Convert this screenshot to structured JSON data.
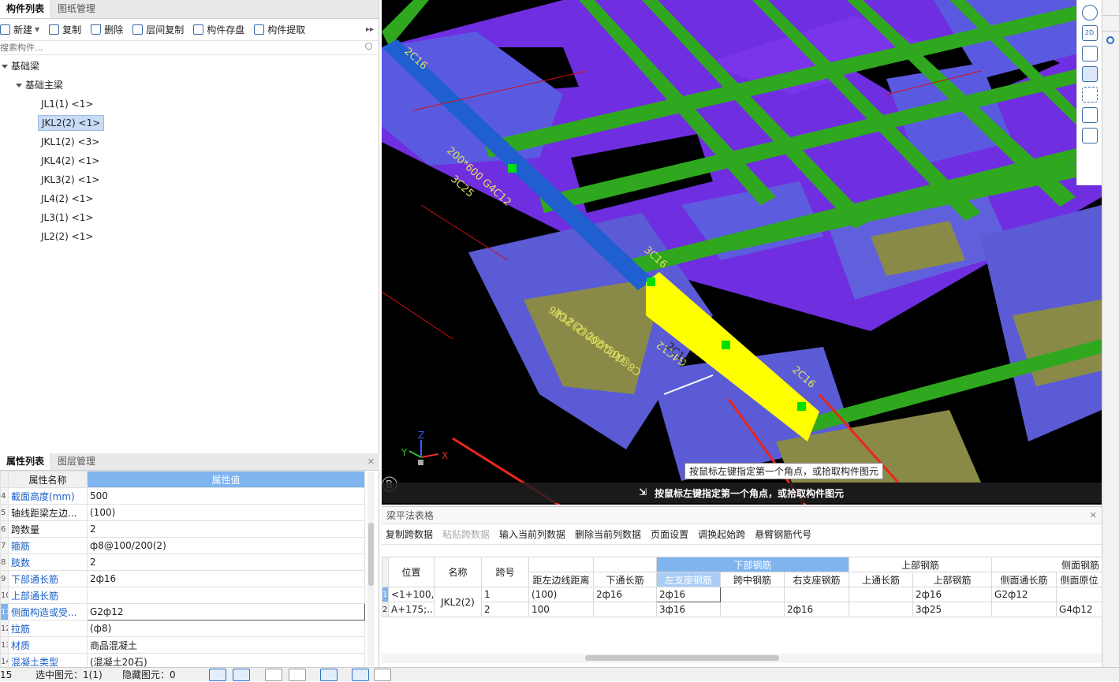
{
  "left_panel": {
    "tabs": [
      "构件列表",
      "图纸管理"
    ],
    "toolbar": [
      {
        "label": "新建",
        "icon": "new-icon"
      },
      {
        "label": "复制",
        "icon": "copy-icon"
      },
      {
        "label": "删除",
        "icon": "delete-icon"
      },
      {
        "label": "层间复制",
        "icon": "floor-copy-icon"
      },
      {
        "label": "构件存盘",
        "icon": "save-component-icon"
      },
      {
        "label": "构件提取",
        "icon": "extract-component-icon"
      }
    ],
    "search_placeholder": "搜索构件...",
    "tree": {
      "root": "基础梁",
      "group": "基础主梁",
      "items": [
        "JL1(1) <1>",
        "JKL2(2) <1>",
        "JKL1(2) <3>",
        "JKL4(2) <1>",
        "JKL3(2) <1>",
        "JL4(2) <1>",
        "JL3(1) <1>",
        "JL2(2) <1>"
      ],
      "selected_index": 1
    }
  },
  "property_panel": {
    "tabs": [
      "属性列表",
      "图层管理"
    ],
    "header": {
      "name": "属性名称",
      "value": "属性值"
    },
    "rows": [
      {
        "n": "4",
        "name": "截面高度(mm)",
        "value": "500",
        "blue": true
      },
      {
        "n": "5",
        "name": "轴线距梁左边...",
        "value": "(100)",
        "blue": false
      },
      {
        "n": "6",
        "name": "跨数量",
        "value": "2",
        "blue": false
      },
      {
        "n": "7",
        "name": "箍筋",
        "value": "ф8@100/200(2)",
        "blue": true
      },
      {
        "n": "8",
        "name": "肢数",
        "value": "2",
        "blue": true
      },
      {
        "n": "9",
        "name": "下部通长筋",
        "value": "2ф16",
        "blue": true
      },
      {
        "n": "10",
        "name": "上部通长筋",
        "value": "",
        "blue": true
      },
      {
        "n": "11",
        "name": "侧面构造或受...",
        "value": "G2ф12",
        "blue": true
      },
      {
        "n": "12",
        "name": "拉筋",
        "value": "(ф8)",
        "blue": true
      },
      {
        "n": "13",
        "name": "材质",
        "value": "商品混凝土",
        "blue": true
      },
      {
        "n": "14",
        "name": "混凝土类型",
        "value": "(混凝土20石)",
        "blue": true
      }
    ]
  },
  "viewport": {
    "labels": [
      "2C16",
      "200*600 G4C12",
      "3C25",
      "3C16",
      "JKL2(2) 200*500",
      "C8@100/200(2) 2C16",
      "G4C12",
      "2C16",
      "2C16"
    ],
    "axis": {
      "x": "X",
      "y": "Y",
      "z": "Z"
    },
    "corner_badge": "B",
    "tooltip": "按鼠标左键指定第一个角点，或拾取构件图元",
    "status_hint": "按鼠标左键指定第一个角点，或拾取构件图元"
  },
  "right_toolbar": [
    "orbit-icon",
    "2d-view-icon",
    "3d-box-icon",
    "view-cube-icon",
    "zoom-extents-icon",
    "isometric-icon",
    "report-icon"
  ],
  "beam_table": {
    "title": "梁平法表格",
    "toolbar": [
      {
        "label": "复制跨数据",
        "enabled": true
      },
      {
        "label": "粘贴跨数据",
        "enabled": false
      },
      {
        "label": "输入当前列数据",
        "enabled": true
      },
      {
        "label": "删除当前列数据",
        "enabled": true
      },
      {
        "label": "页面设置",
        "enabled": true
      },
      {
        "label": "调换起始跨",
        "enabled": true
      },
      {
        "label": "悬臂钢筋代号",
        "enabled": true
      }
    ],
    "group_headers": {
      "bottom": "下部钢筋",
      "top": "上部钢筋",
      "side": "侧面钢筋"
    },
    "columns": [
      "位置",
      "名称",
      "跨号",
      "距左边线距离",
      "下通长筋",
      "左支座钢筋",
      "跨中钢筋",
      "右支座钢筋",
      "上通长筋",
      "上部钢筋",
      "侧面通长筋",
      "侧面原位"
    ],
    "rows": [
      {
        "rn": "1",
        "pos": "<1+100,",
        "name": "JKL2(2)",
        "span": "1",
        "dist": "(100)",
        "bot_through": "2ф16",
        "left_seat": "2ф16",
        "mid": "",
        "right_seat": "",
        "top_through": "",
        "top": "2ф16",
        "side_through": "G2ф12",
        "side_local": ""
      },
      {
        "rn": "2",
        "pos": "A+175;...",
        "name": "",
        "span": "2",
        "dist": "100",
        "bot_through": "",
        "left_seat": "3ф16",
        "mid": "",
        "right_seat": "2ф16",
        "top_through": "",
        "top": "3ф25",
        "side_through": "",
        "side_local": "G4ф12"
      }
    ]
  },
  "status_bar": {
    "floor": "15",
    "selected_label": "选中图元：",
    "selected_value": "1(1)",
    "hidden_label": "隐藏图元：",
    "hidden_value": "0"
  },
  "colors": {
    "beam_purple": "#8a2be2",
    "rebar_green": "#2fa81f",
    "selected_yellow": "#ffff00",
    "column_blue": "#5b5bd6",
    "highlight_blue": "#7fb4ef",
    "arrow_red": "#e8261a"
  }
}
